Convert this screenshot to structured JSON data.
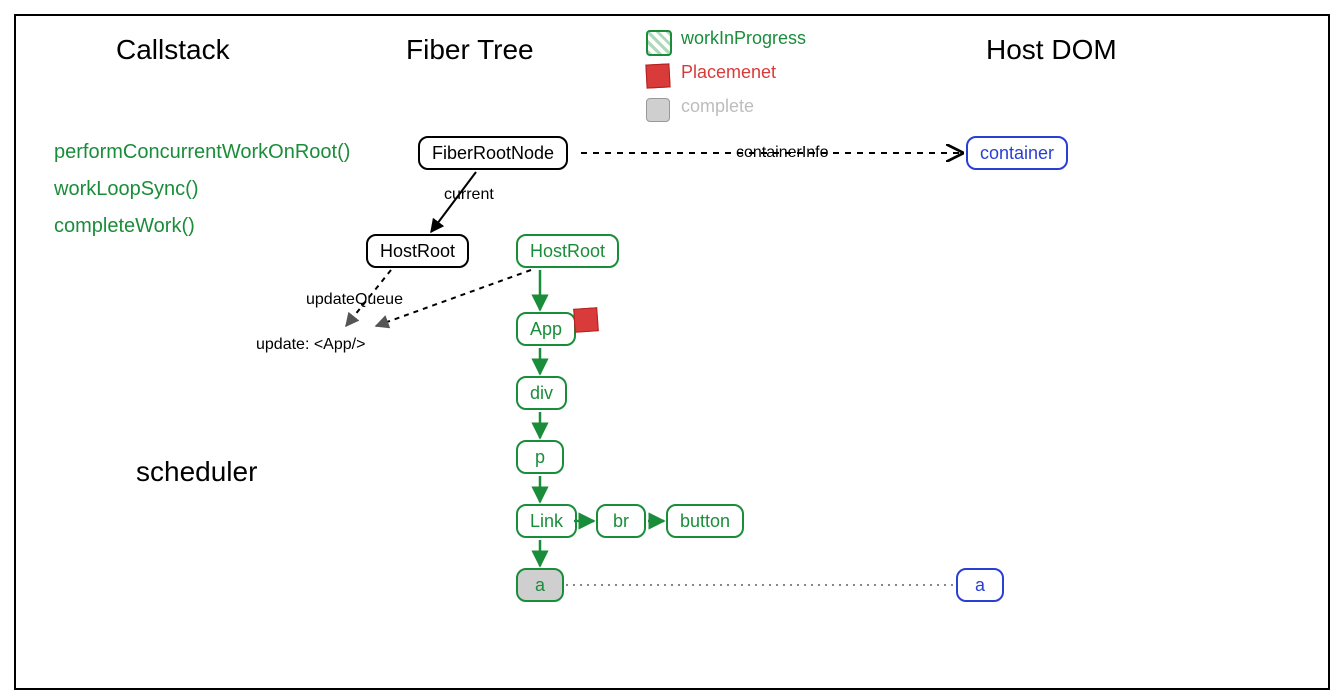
{
  "headings": {
    "callstack": "Callstack",
    "fiber_tree": "Fiber Tree",
    "host_dom": "Host DOM",
    "scheduler": "scheduler"
  },
  "callstack": {
    "items": [
      "performConcurrentWorkOnRoot()",
      "workLoopSync()",
      "completeWork()"
    ]
  },
  "legend": {
    "wip": "workInProgress",
    "placement": "Placemenet",
    "complete": "complete"
  },
  "nodes": {
    "fiber_root": "FiberRootNode",
    "host_root_current": "HostRoot",
    "host_root_wip": "HostRoot",
    "app": "App",
    "div": "div",
    "p": "p",
    "link": "Link",
    "br": "br",
    "button": "button",
    "a": "a",
    "container": "container",
    "dom_a": "a"
  },
  "edges": {
    "current": "current",
    "updateQueue": "updateQueue",
    "update_app": "update: <App/>",
    "containerInfo": "containerInfo"
  },
  "colors": {
    "green": "#1a8d3a",
    "red": "#d93a3a",
    "blue": "#2a3fd4",
    "gray": "#cfcfcf"
  }
}
